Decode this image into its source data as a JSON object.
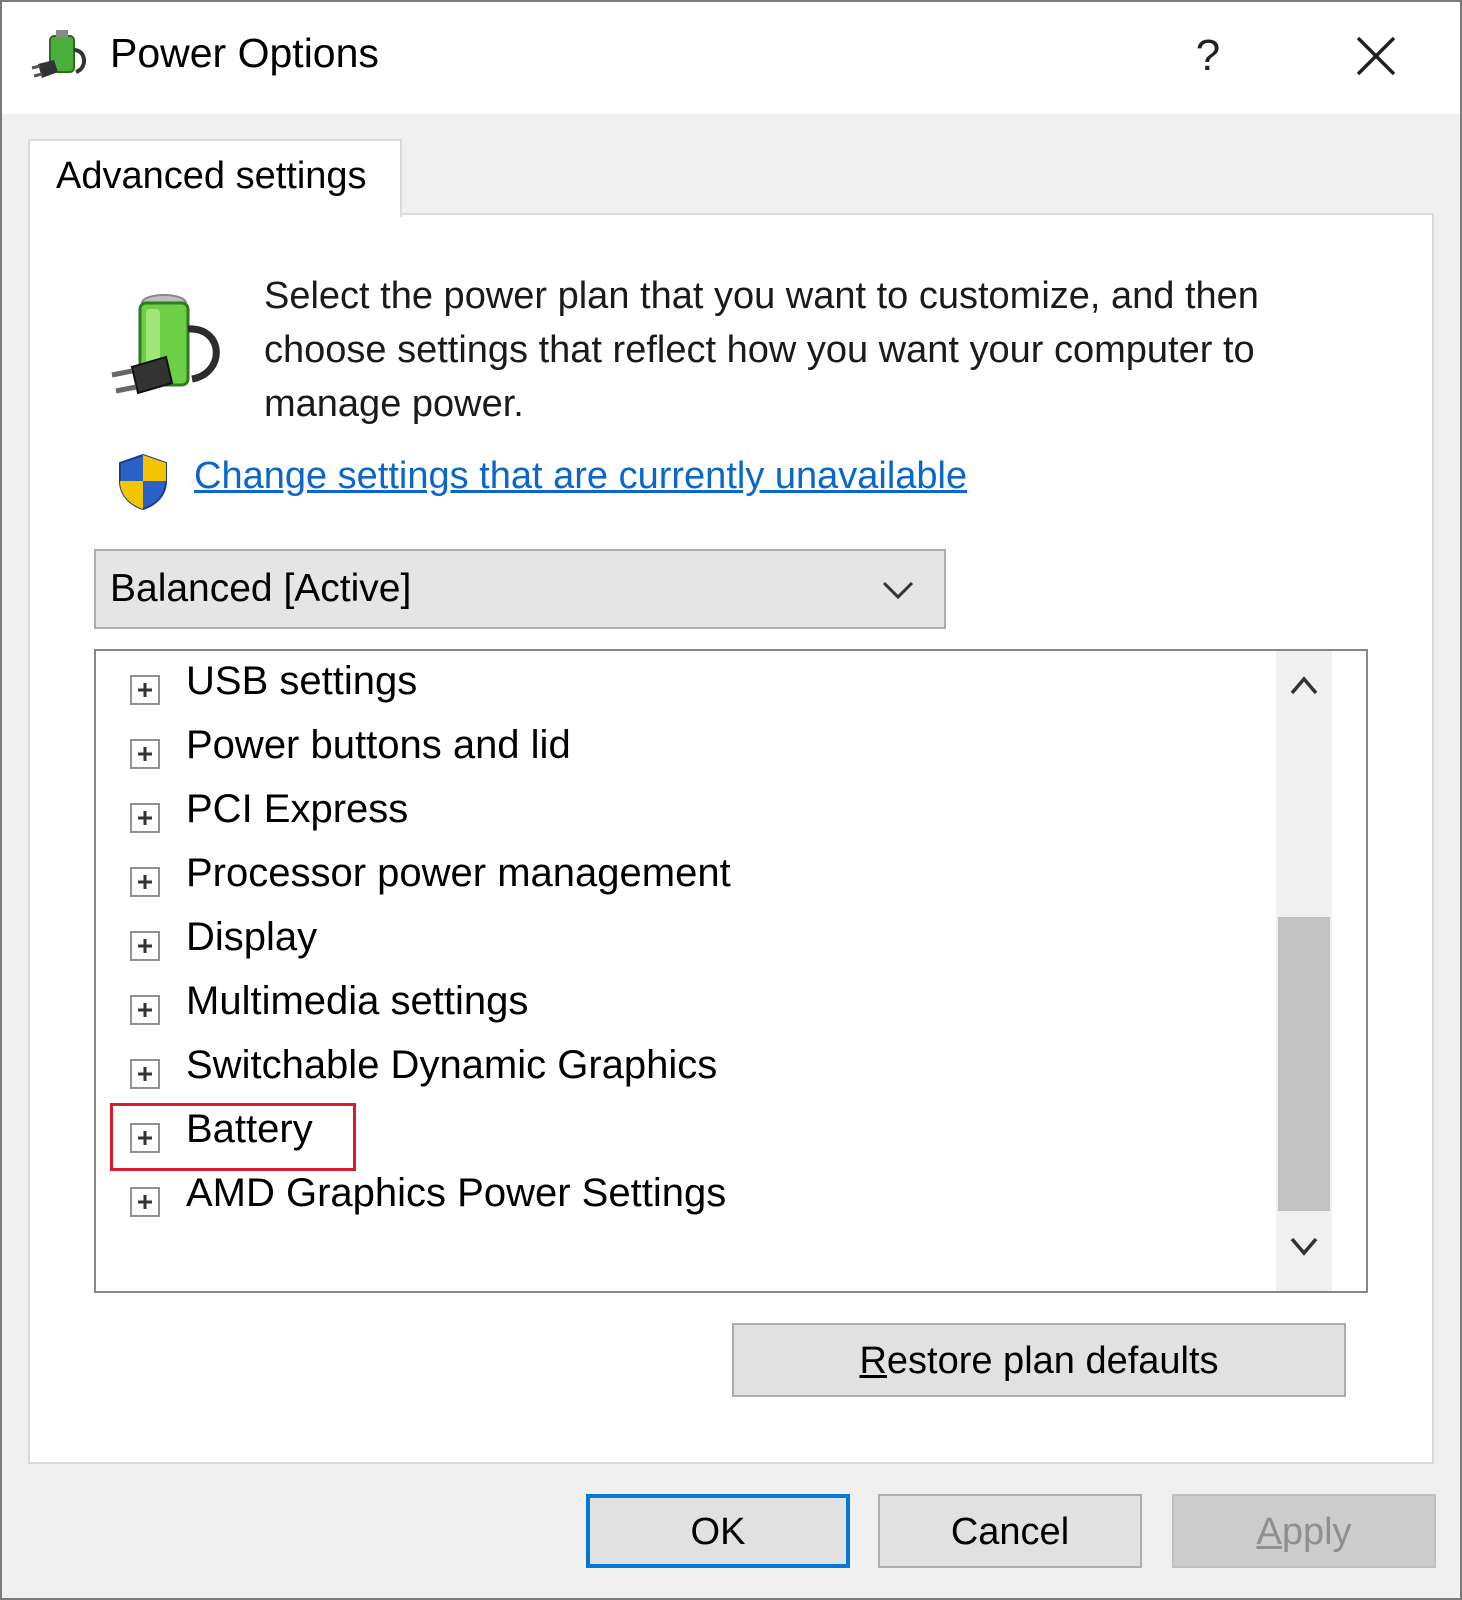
{
  "window": {
    "title": "Power Options",
    "help_label": "?"
  },
  "tabs": [
    {
      "label": "Advanced settings"
    }
  ],
  "panel": {
    "description": "Select the power plan that you want to customize, and then choose settings that reflect how you want your computer to manage power.",
    "change_link": "Change settings that are currently unavailable",
    "plan_select": {
      "value": "Balanced [Active]"
    }
  },
  "settings_tree": {
    "items": [
      {
        "label": "USB settings"
      },
      {
        "label": "Power buttons and lid"
      },
      {
        "label": "PCI Express"
      },
      {
        "label": "Processor power management"
      },
      {
        "label": "Display"
      },
      {
        "label": "Multimedia settings"
      },
      {
        "label": "Switchable Dynamic Graphics"
      },
      {
        "label": "Battery"
      },
      {
        "label": "AMD Graphics Power Settings"
      }
    ],
    "highlighted_item": "Battery",
    "highlight_color": "#d81e2c"
  },
  "buttons": {
    "restore_first": "R",
    "restore_rest": "estore plan defaults",
    "ok": "OK",
    "cancel": "Cancel",
    "apply_first": "A",
    "apply_rest": "pply"
  },
  "icons": {
    "title": "power-options-icon",
    "panel": "battery-plug-icon",
    "link": "uac-shield-icon",
    "close": "close-icon",
    "dropdown": "chevron-down-icon",
    "expander": "plus-box-icon"
  },
  "colors": {
    "link": "#0b66cc",
    "focus_border": "#0078d7"
  }
}
